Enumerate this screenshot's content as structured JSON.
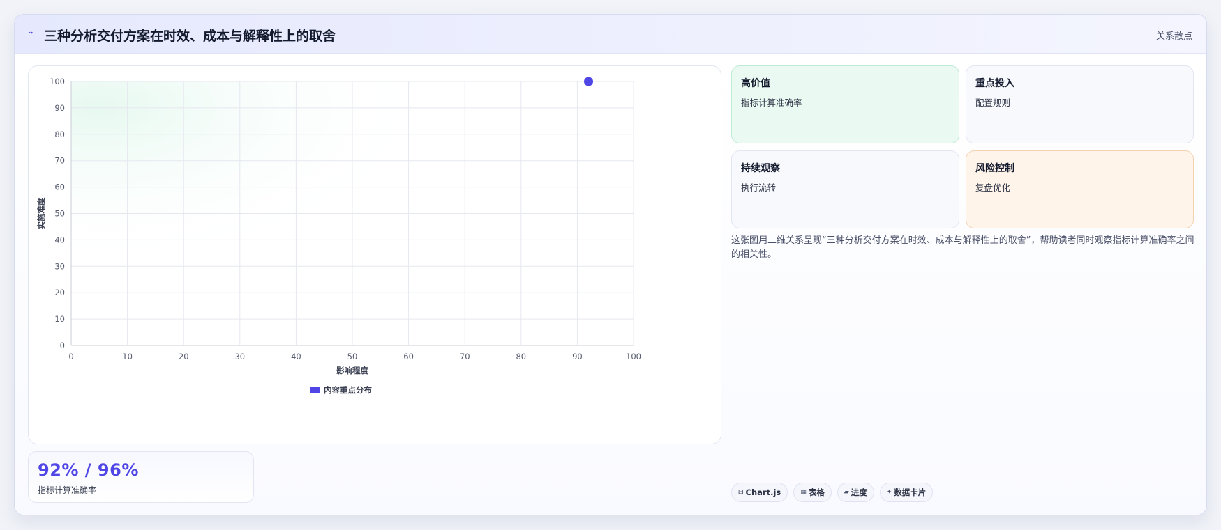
{
  "header": {
    "icon": "lightning-icon",
    "title": "三种分析交付方案在时效、成本与解释性上的取舍",
    "tag": "关系散点"
  },
  "chart_data": {
    "type": "scatter",
    "xlabel": "影响程度",
    "ylabel": "实施难度",
    "xlim": [
      0,
      100
    ],
    "ylim": [
      0,
      100
    ],
    "xticks": [
      0,
      10,
      20,
      30,
      40,
      50,
      60,
      70,
      80,
      90,
      100
    ],
    "yticks": [
      0,
      10,
      20,
      30,
      40,
      50,
      60,
      70,
      80,
      90,
      100
    ],
    "grid": true,
    "legend_position": "bottom",
    "series": [
      {
        "name": "内容重点分布",
        "color": "#4f46e5",
        "points": [
          {
            "x": 92,
            "y": 100
          }
        ]
      }
    ]
  },
  "kpi": {
    "value": "92% / 96%",
    "label": "指标计算准确率"
  },
  "cards": [
    {
      "title": "高价值",
      "subtitle": "指标计算准确率",
      "tone": "green"
    },
    {
      "title": "重点投入",
      "subtitle": "配置规则",
      "tone": "neutral"
    },
    {
      "title": "持续观察",
      "subtitle": "执行流转",
      "tone": "neutral"
    },
    {
      "title": "风险控制",
      "subtitle": "复盘优化",
      "tone": "orange"
    }
  ],
  "description": "这张图用二维关系呈现“三种分析交付方案在时效、成本与解释性上的取舍”，帮助读者同时观察指标计算准确率之间的相关性。",
  "chips": [
    {
      "icon": "chart-icon",
      "glyph": "⊟",
      "label": "Chart.js"
    },
    {
      "icon": "table-icon",
      "glyph": "▦",
      "label": "表格"
    },
    {
      "icon": "progress-icon",
      "glyph": "▰",
      "label": "进度"
    },
    {
      "icon": "sparkle-icon",
      "glyph": "✦",
      "label": "数据卡片"
    }
  ]
}
